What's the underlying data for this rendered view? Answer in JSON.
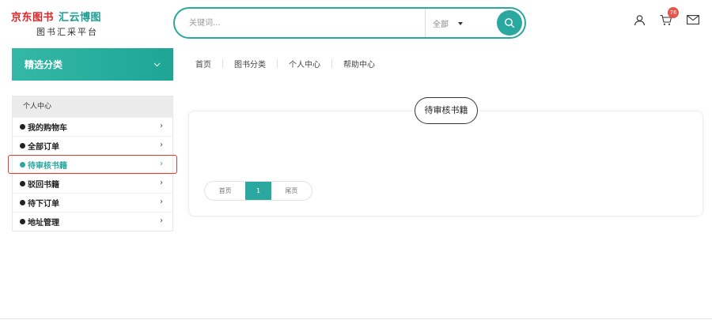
{
  "header": {
    "logo_jd": "京东图书",
    "logo_hy": "汇云博图",
    "logo_sub": "图书汇采平台",
    "search_placeholder": "关键词...",
    "search_category": "全部",
    "cart_count": "76"
  },
  "category": {
    "title": "精选分类"
  },
  "nav": {
    "items": [
      "首页",
      "图书分类",
      "个人中心",
      "帮助中心"
    ]
  },
  "sidebar": {
    "title": "个人中心",
    "items": [
      "我的购物车",
      "全部订单",
      "待审核书籍",
      "驳回书籍",
      "待下订单",
      "地址管理"
    ],
    "active_index": 2
  },
  "main": {
    "title": "待审核书籍",
    "pager": {
      "first": "首页",
      "current": "1",
      "last": "尾页"
    }
  },
  "colors": {
    "accent": "#2aa89f",
    "brand_red": "#d9262b",
    "highlight_border": "#e8392f",
    "badge": "#e9534a"
  }
}
